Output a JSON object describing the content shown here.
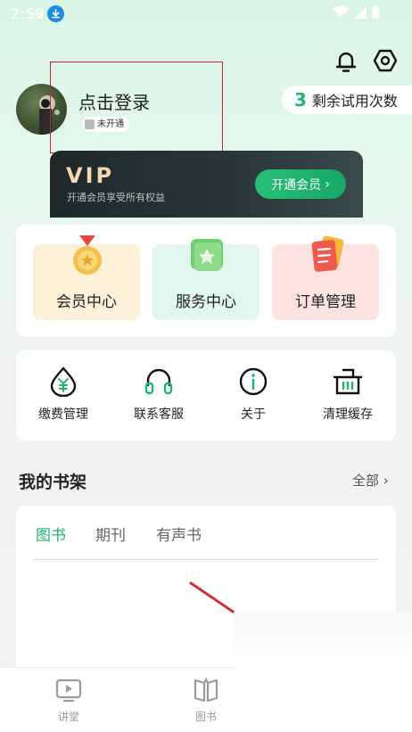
{
  "status_bar": {
    "time": "2:59"
  },
  "profile": {
    "login_text": "点击登录",
    "member_status": "未开通",
    "trial_count": "3",
    "trial_label": "剩余试用次数"
  },
  "vip": {
    "title": "VIP",
    "subtitle": "开通会员享受所有权益",
    "button_label": "开通会员"
  },
  "features": [
    {
      "label": "会员中心",
      "icon": "medal-icon"
    },
    {
      "label": "服务中心",
      "icon": "star-book-icon"
    },
    {
      "label": "订单管理",
      "icon": "order-list-icon"
    }
  ],
  "tools": [
    {
      "label": "缴费管理",
      "icon": "payment-drop-icon"
    },
    {
      "label": "联系客服",
      "icon": "headset-icon"
    },
    {
      "label": "关于",
      "icon": "info-icon"
    },
    {
      "label": "清理缓存",
      "icon": "basket-icon"
    }
  ],
  "shelf": {
    "title": "我的书架",
    "all_label": "全部",
    "tabs": [
      "图书",
      "期刊",
      "有声书"
    ],
    "active_tab": 0
  },
  "bottom_nav": [
    {
      "label": "讲堂",
      "icon": "play-screen-icon"
    },
    {
      "label": "图书",
      "icon": "open-book-icon"
    }
  ],
  "colors": {
    "accent_green": "#1fb56e",
    "vip_gold": "#f2d7b0",
    "annotation_red": "#c8282d"
  }
}
